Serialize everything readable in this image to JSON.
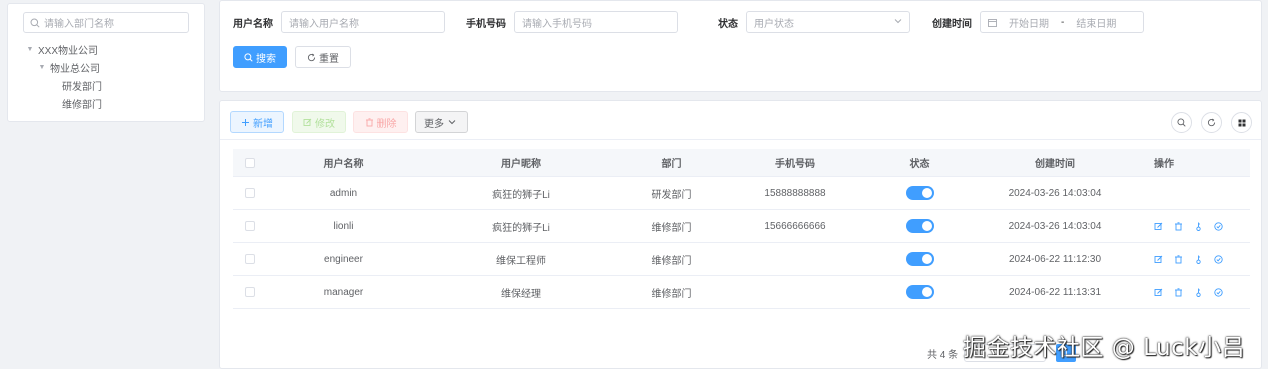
{
  "dept_tree": {
    "search_placeholder": "请输入部门名称",
    "nodes": [
      {
        "label": "XXX物业公司",
        "level": 0,
        "expanded": true
      },
      {
        "label": "物业总公司",
        "level": 1,
        "expanded": true
      },
      {
        "label": "研发部门",
        "level": 2
      },
      {
        "label": "维修部门",
        "level": 2
      }
    ]
  },
  "search_form": {
    "username_label": "用户名称",
    "username_placeholder": "请输入用户名称",
    "phone_label": "手机号码",
    "phone_placeholder": "请输入手机号码",
    "status_label": "状态",
    "status_placeholder": "用户状态",
    "created_label": "创建时间",
    "start_date_placeholder": "开始日期",
    "date_separator": "-",
    "end_date_placeholder": "结束日期",
    "search_button": "搜索",
    "reset_button": "重置"
  },
  "toolbar": {
    "add_label": "新增",
    "edit_label": "修改",
    "delete_label": "删除",
    "more_label": "更多"
  },
  "table": {
    "columns": [
      "用户名称",
      "用户昵称",
      "部门",
      "手机号码",
      "状态",
      "创建时间",
      "操作"
    ],
    "rows": [
      {
        "username": "admin",
        "nickname": "疯狂的狮子Li",
        "dept": "研发部门",
        "phone": "15888888888",
        "status_on": true,
        "created": "2024-03-26 14:03:04",
        "has_ops": false
      },
      {
        "username": "lionli",
        "nickname": "疯狂的狮子Li",
        "dept": "维修部门",
        "phone": "15666666666",
        "status_on": true,
        "created": "2024-03-26 14:03:04",
        "has_ops": true
      },
      {
        "username": "engineer",
        "nickname": "维保工程师",
        "dept": "维修部门",
        "phone": "",
        "status_on": true,
        "created": "2024-06-22 11:12:30",
        "has_ops": true
      },
      {
        "username": "manager",
        "nickname": "维保经理",
        "dept": "维修部门",
        "phone": "",
        "status_on": true,
        "created": "2024-06-22 11:13:31",
        "has_ops": true
      }
    ]
  },
  "pagination": {
    "total_text": "共 4 条",
    "current_page": "1"
  },
  "watermark": "掘金技术社区 @ Luck小吕",
  "colors": {
    "primary": "#409eff",
    "border": "#dcdfe6",
    "background": "#f0f2f5"
  }
}
